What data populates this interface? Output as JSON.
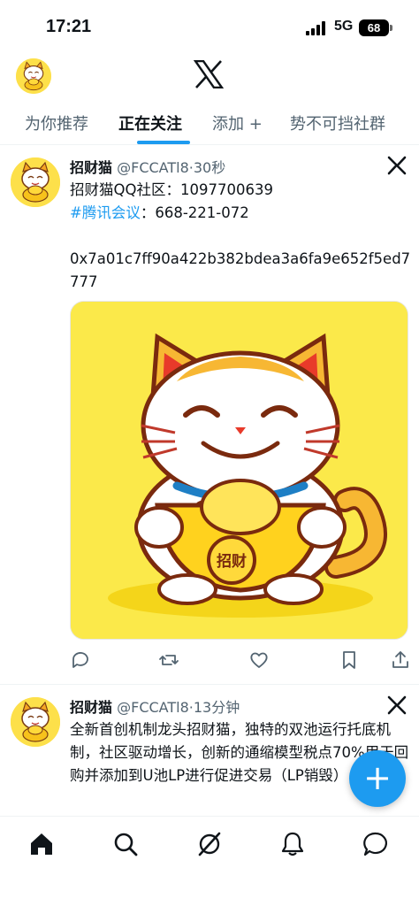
{
  "status_bar": {
    "time": "17:21",
    "network": "5G",
    "battery": "68"
  },
  "header": {
    "logo_icon": "x-logo-icon",
    "avatar_icon": "lucky-cat-avatar-icon"
  },
  "tabs": [
    {
      "label": "为你推荐",
      "active": false
    },
    {
      "label": "正在关注",
      "active": true
    },
    {
      "label": "添加 +",
      "active": false
    },
    {
      "label": "势不可挡社群",
      "active": false
    }
  ],
  "posts": [
    {
      "author": "招财猫",
      "handle": "@FCCATl8",
      "time": "·30秒",
      "line1": "招财猫QQ社区：1097700639",
      "hashtag": "#腾讯会议",
      "line2_rest": "：668-221-072",
      "line3": "0x7a01c7ff90a422b382bdea3a6fa9e652f5ed7777",
      "image_badge": "招财"
    },
    {
      "author": "招财猫",
      "handle": "@FCCATl8",
      "time": "·13分钟",
      "text": "全新首创机制龙头招财猫，独特的双池运行托底机制，社区驱动增长，创新的通缩模型税点70%用于回购并添加到U池LP进行促进交易（LP销毁）"
    }
  ],
  "fab": {
    "label": "+"
  },
  "colors": {
    "accent": "#1d9bf0",
    "text": "#0f1419",
    "muted": "#536471",
    "image_bg": "#fbe94a"
  },
  "bottom_nav": [
    "home-icon",
    "search-icon",
    "grok-icon",
    "notifications-icon",
    "messages-icon"
  ]
}
